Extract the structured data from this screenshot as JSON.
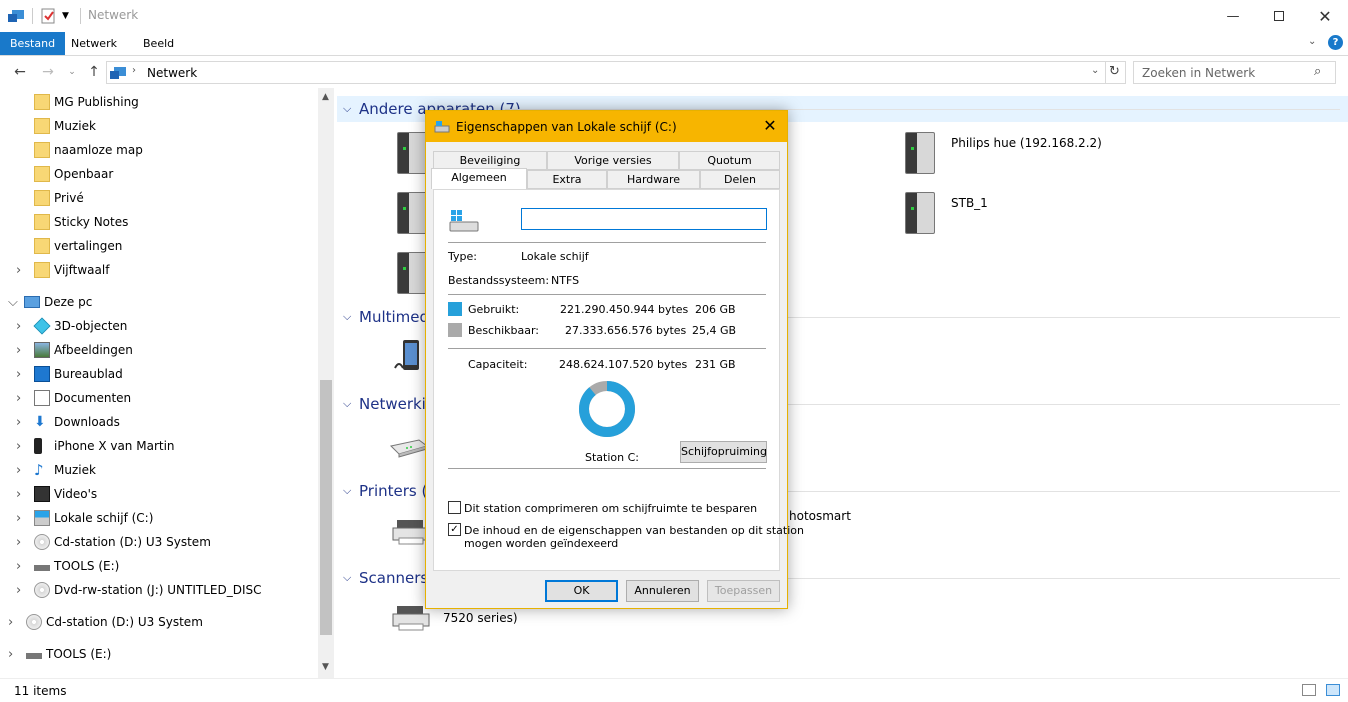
{
  "window": {
    "title": "Netwerk"
  },
  "ribbon": {
    "tabs": [
      "Bestand",
      "Netwerk",
      "Beeld"
    ]
  },
  "address": {
    "path": "Netwerk",
    "search_placeholder": "Zoeken in Netwerk"
  },
  "nav": {
    "items": [
      {
        "label": "MG Publishing"
      },
      {
        "label": "Muziek"
      },
      {
        "label": "naamloze map"
      },
      {
        "label": "Openbaar"
      },
      {
        "label": "Privé"
      },
      {
        "label": "Sticky Notes"
      },
      {
        "label": "vertalingen"
      },
      {
        "label": "Vijftwaalf"
      },
      {
        "label": "Deze pc"
      },
      {
        "label": "3D-objecten"
      },
      {
        "label": "Afbeeldingen"
      },
      {
        "label": "Bureaublad"
      },
      {
        "label": "Documenten"
      },
      {
        "label": "Downloads"
      },
      {
        "label": "iPhone X van Martin"
      },
      {
        "label": "Muziek"
      },
      {
        "label": "Video's"
      },
      {
        "label": "Lokale schijf (C:)"
      },
      {
        "label": "Cd-station (D:) U3 System"
      },
      {
        "label": "TOOLS (E:)"
      },
      {
        "label": "Dvd-rw-station (J:) UNTITLED_DISC"
      },
      {
        "label": "Cd-station (D:) U3 System"
      },
      {
        "label": "TOOLS (E:)"
      }
    ]
  },
  "content": {
    "groups": [
      {
        "title": "Andere apparaten (7)"
      },
      {
        "title": "Multimedi"
      },
      {
        "title": "Netwerkin"
      },
      {
        "title": "Printers (2"
      },
      {
        "title": "Scanners ("
      }
    ],
    "devices": [
      {
        "label": "Philips hue (192.168.2.2)"
      },
      {
        "label": "STB_1"
      },
      {
        "label": "hotosmart"
      },
      {
        "label": "7520 series)"
      }
    ]
  },
  "status": {
    "items": "11 items"
  },
  "dialog": {
    "title": "Eigenschappen van Lokale schijf (C:)",
    "tabs_row1": [
      "Beveiliging",
      "Vorige versies",
      "Quotum"
    ],
    "tabs_row2": [
      "Algemeen",
      "Extra",
      "Hardware",
      "Delen"
    ],
    "name_value": "",
    "type_label": "Type:",
    "type_value": "Lokale schijf",
    "fs_label": "Bestandssysteem:",
    "fs_value": "NTFS",
    "used_label": "Gebruikt:",
    "used_bytes": "221.290.450.944 bytes",
    "used_gb": "206 GB",
    "free_label": "Beschikbaar:",
    "free_bytes": "27.333.656.576 bytes",
    "free_gb": "25,4 GB",
    "cap_label": "Capaciteit:",
    "cap_bytes": "248.624.107.520 bytes",
    "cap_gb": "231 GB",
    "station_label": "Station C:",
    "cleanup_button": "Schijfopruiming",
    "compress_label": "Dit station comprimeren om schijfruimte te besparen",
    "compress_checked": false,
    "index_label_1": "De inhoud en de eigenschappen van bestanden op dit station",
    "index_label_2": "mogen worden geïndexeerd",
    "index_checked": true,
    "used_fraction": 0.89,
    "ok_button": "OK",
    "cancel_button": "Annuleren",
    "apply_button": "Toepassen",
    "colors": {
      "used": "#26a0da",
      "free": "#aaaaaa",
      "title_bg": "#f7b500"
    }
  }
}
